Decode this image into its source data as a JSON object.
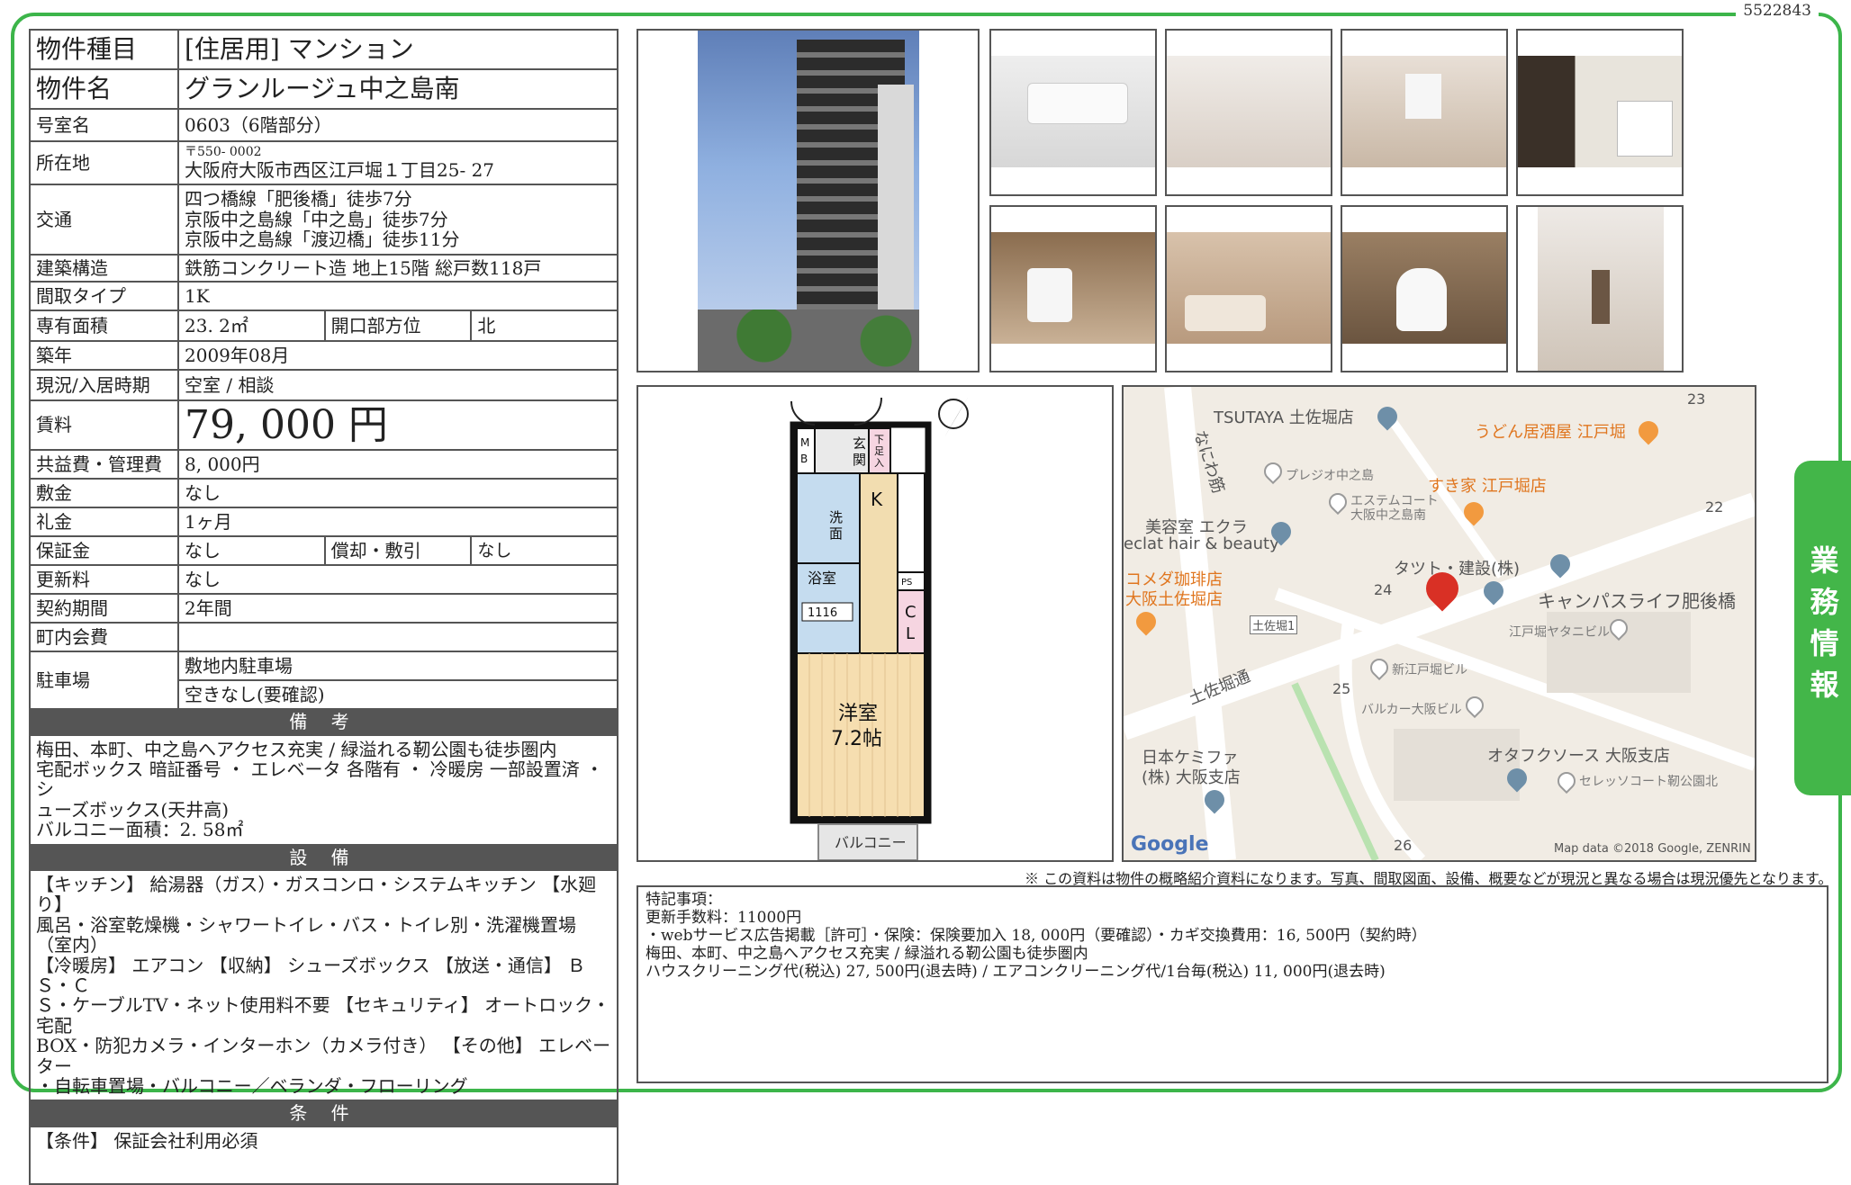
{
  "doc_number": "5522843",
  "property": {
    "type_label": "物件種目",
    "type_value": "[住居用] マンション",
    "name_label": "物件名",
    "name_value": "グランルージュ中之島南",
    "room_label": "号室名",
    "room_value": "0603（6階部分）",
    "address_label": "所在地",
    "address_zip": "〒550- 0002",
    "address_value": "大阪府大阪市西区江戸堀１丁目25- 27",
    "transport_label": "交通",
    "transport_lines": [
      "四つ橋線「肥後橋」徒歩7分",
      "京阪中之島線「中之島」徒歩7分",
      "京阪中之島線「渡辺橋」徒歩11分"
    ],
    "structure_label": "建築構造",
    "structure_value": "鉄筋コンクリート造 地上15階 総戸数118戸",
    "layout_label": "間取タイプ",
    "layout_value": "1K",
    "area_label": "専有面積",
    "area_value": "23. 2㎡",
    "direction_label": "開口部方位",
    "direction_value": "北",
    "built_label": "築年",
    "built_value": "2009年08月",
    "status_label": "現況/入居時期",
    "status_value": "空室 / 相談",
    "rent_label": "賃料",
    "rent_value": "79, 000 円",
    "fee_label": "共益費・管理費",
    "fee_value": "8, 000円",
    "deposit_label": "敷金",
    "deposit_value": "なし",
    "key_money_label": "礼金",
    "key_money_value": "1ヶ月",
    "guarantee_label": "保証金",
    "guarantee_value": "なし",
    "amort_label": "償却・敷引",
    "amort_value": "なし",
    "renewal_label": "更新料",
    "renewal_value": "なし",
    "contract_label": "契約期間",
    "contract_value": "2年間",
    "town_fee_label": "町内会費",
    "town_fee_value": "",
    "parking_label": "駐車場",
    "parking_value_1": "敷地内駐車場",
    "parking_value_2": "空きなし(要確認)"
  },
  "remarks": {
    "title": "備 考",
    "lines": [
      "梅田、本町、中之島へアクセス充実 / 緑溢れる靭公園も徒歩圏内",
      "宅配ボックス 暗証番号 ・ エレベータ 各階有 ・ 冷暖房 一部設置済 ・ シ",
      "ューズボックス(天井高)",
      "バルコニー面積：2. 58㎡"
    ]
  },
  "equipment": {
    "title": "設 備",
    "lines": [
      "【キッチン】 給湯器（ガス）・ガスコンロ・システムキッチン 【水廻り】",
      "風呂・浴室乾燥機・シャワートイレ・バス・トイレ別・洗濯機置場（室内）",
      "【冷暖房】 エアコン 【収納】 シューズボックス 【放送・通信】 ＢＳ・Ｃ",
      "Ｓ・ケーブルTV・ネット使用料不要 【セキュリティ】 オートロック・宅配",
      "BOX・防犯カメラ・インターホン（カメラ付き） 【その他】 エレベーター",
      "・自転車置場・バルコニー／ベランダ・フローリング"
    ]
  },
  "conditions": {
    "title": "条 件",
    "lines": [
      "【条件】 保証会社利用必須"
    ]
  },
  "floorplan": {
    "labels": {
      "mb": "M\nB",
      "genkan": "玄\n関",
      "shoes": "下\n足\n入",
      "k": "K",
      "wash": "洗\n面",
      "bath": "浴室",
      "bath_size": "1116",
      "ps": "PS",
      "cl": "C\nL",
      "room": "洋室",
      "room_size": "7.2帖",
      "balcony": "バルコニー"
    }
  },
  "map": {
    "labels": [
      "TSUTAYA 土佐堀店",
      "うどん居酒屋 江戸堀",
      "プレジオ中之島",
      "エステムコート",
      "大阪中之島南",
      "すき家 江戸堀店",
      "美容室 エクラ",
      "eclat hair & beauty",
      "コメダ珈琲店",
      "大阪土佐堀店",
      "タツト・建設(株)",
      "キャンパスライフ肥後橋",
      "江戸堀ヤタニビル",
      "土佐堀1",
      "新江戸堀ビル",
      "土佐堀通",
      "バルカー大阪ビル",
      "日本ケミファ",
      "(株) 大阪支店",
      "オタフクソース 大阪支店",
      "セレッソコート靭公園北",
      "なにわ筋",
      "23",
      "22",
      "24",
      "25",
      "26",
      "Google",
      "Map data ©2018 Google, ZENRIN"
    ]
  },
  "disclaimer": "※ この資料は物件の概略紹介資料になります。写真、間取図面、設備、概要などが現況と異なる場合は現況優先となります。",
  "notes": {
    "lines": [
      "特記事項：",
      "更新手数料：11000円",
      "・webサービス広告掲載［許可］・保険：保険要加入 18, 000円（要確認）・カギ交換費用：16, 500円（契約時）",
      "梅田、本町、中之島へアクセス充実 / 緑溢れる靭公園も徒歩圏内",
      "ハウスクリーニング代(税込) 27, 500円(退去時) / エアコンクリーニング代/1台毎(税込) 11, 000円(退去時)"
    ]
  },
  "side_tab": "業務情報"
}
